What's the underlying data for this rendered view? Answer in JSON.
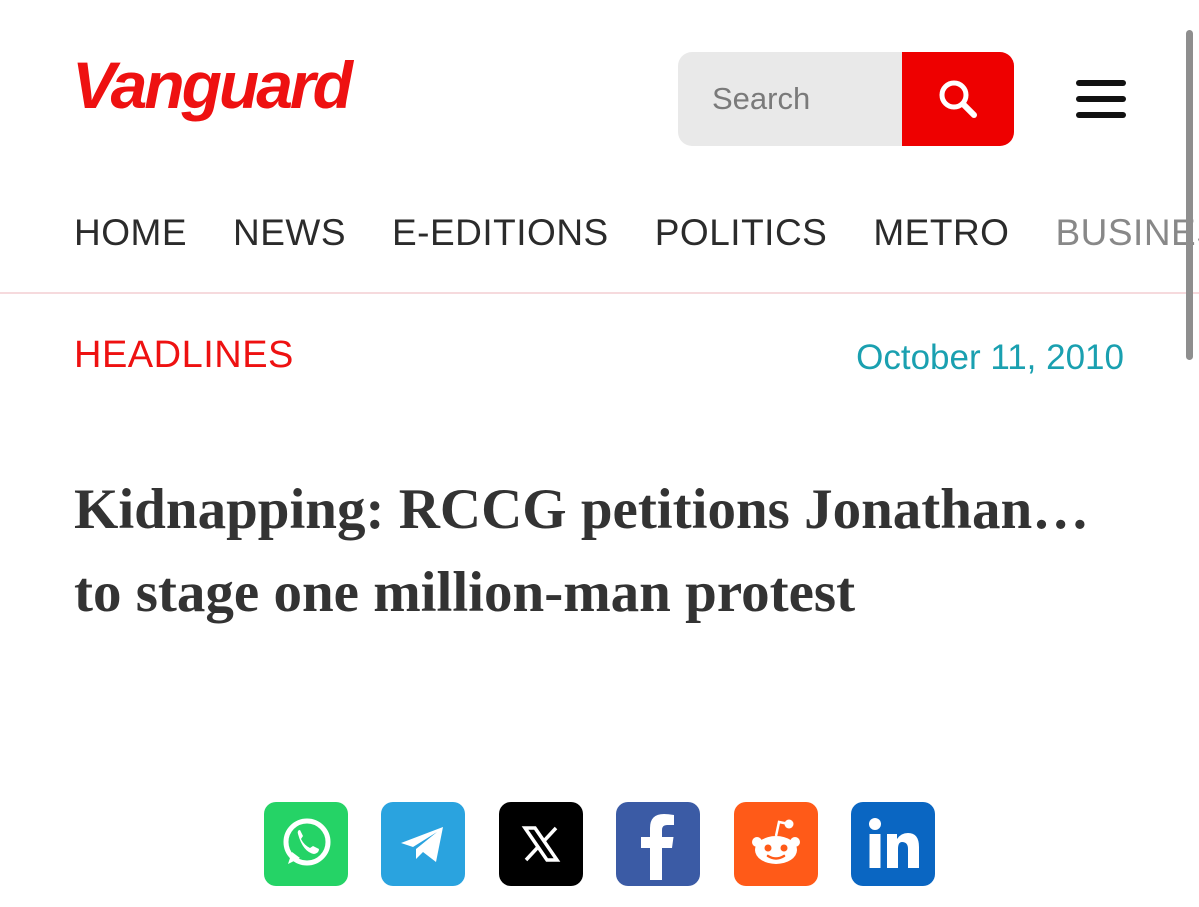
{
  "brand": {
    "logo_text": "Vanguard",
    "accent": "#ee1111"
  },
  "search": {
    "placeholder": "Search",
    "button_icon": "search-icon"
  },
  "menu": {
    "icon": "hamburger-menu-icon"
  },
  "nav": {
    "items": [
      "HOME",
      "NEWS",
      "E-EDITIONS",
      "POLITICS",
      "METRO",
      "BUSINESS"
    ]
  },
  "article": {
    "category": "HEADLINES",
    "date": "October 11, 2010",
    "headline": "Kidnapping: RCCG petitions Jonathan…to stage one million-man protest"
  },
  "share": {
    "buttons": [
      {
        "icon": "whatsapp-icon",
        "color": "#25d366"
      },
      {
        "icon": "telegram-icon",
        "color": "#2aa3df"
      },
      {
        "icon": "x-icon",
        "color": "#000000"
      },
      {
        "icon": "facebook-icon",
        "color": "#3b5ba5"
      },
      {
        "icon": "reddit-icon",
        "color": "#ff5a18"
      },
      {
        "icon": "linkedin-icon",
        "color": "#0a66c2"
      }
    ]
  }
}
